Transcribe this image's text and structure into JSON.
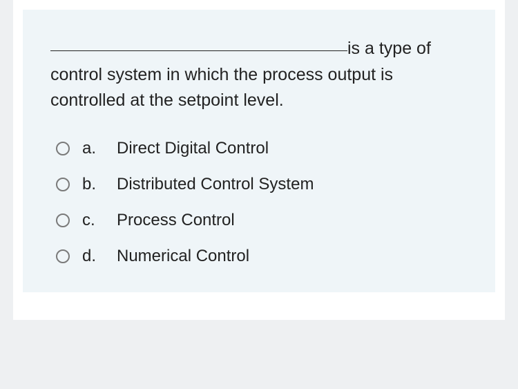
{
  "question": {
    "text_after_blank": "is a type of control system in which the process output is controlled at the setpoint level."
  },
  "options": [
    {
      "letter": "a.",
      "text": "Direct Digital Control"
    },
    {
      "letter": "b.",
      "text": "Distributed Control System"
    },
    {
      "letter": "c.",
      "text": "Process Control"
    },
    {
      "letter": "d.",
      "text": "Numerical Control"
    }
  ]
}
